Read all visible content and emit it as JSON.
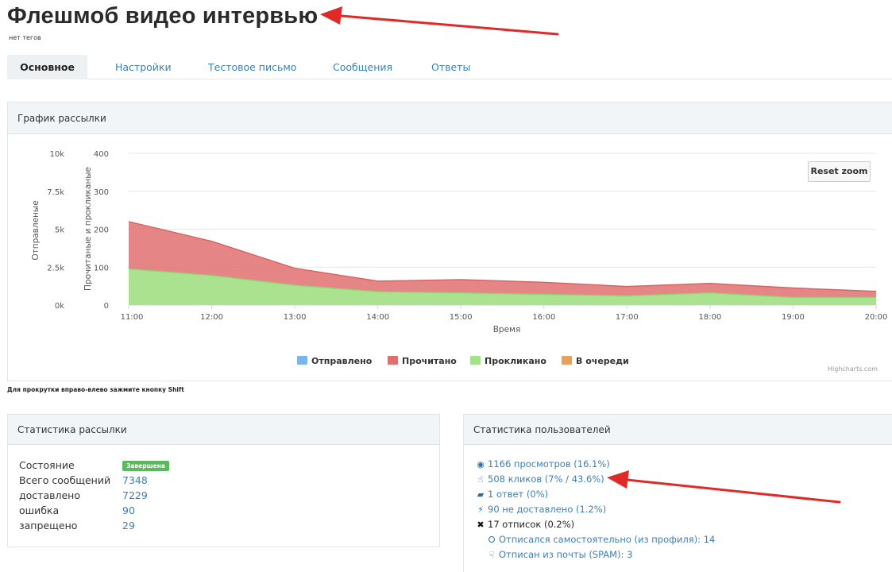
{
  "header": {
    "title": "Флешмоб видео интервью",
    "tags": "нет тегов"
  },
  "tabs": [
    {
      "label": "Основное",
      "active": true
    },
    {
      "label": "Настройки",
      "active": false
    },
    {
      "label": "Тестовое письмо",
      "active": false
    },
    {
      "label": "Сообщения",
      "active": false
    },
    {
      "label": "Ответы",
      "active": false
    }
  ],
  "chart_panel": {
    "title": "График рассылки",
    "reset_zoom": "Reset zoom",
    "credits": "Highcharts.com",
    "scroll_hint": "Для прокрутки вправо-влево зажмите кнопку Shift"
  },
  "chart_data": {
    "type": "area",
    "x": [
      "11:00",
      "12:00",
      "13:00",
      "14:00",
      "15:00",
      "16:00",
      "17:00",
      "18:00",
      "19:00",
      "20:00"
    ],
    "xlabel": "Время",
    "y_left": {
      "label": "Отправленые",
      "ticks": [
        "0k",
        "2.5k",
        "5k",
        "7.5k",
        "10k"
      ],
      "range": [
        0,
        10000
      ]
    },
    "y_right": {
      "label": "Прочитаные и прокликаные",
      "ticks": [
        "0",
        "100",
        "200",
        "300",
        "400"
      ],
      "range": [
        0,
        400
      ]
    },
    "stacked": true,
    "series": [
      {
        "name": "Отправлено",
        "color": "#7cb5ec",
        "values": [
          0,
          0,
          0,
          0,
          0,
          0,
          0,
          0,
          0,
          0
        ]
      },
      {
        "name": "Прочитано",
        "color": "#e07070",
        "values": [
          125,
          90,
          45,
          28,
          35,
          32,
          25,
          25,
          25,
          16
        ]
      },
      {
        "name": "Прокликано",
        "color": "#a5e08a",
        "values": [
          95,
          78,
          52,
          35,
          32,
          28,
          24,
          32,
          20,
          20
        ]
      },
      {
        "name": "В очереди",
        "color": "#e8a05a",
        "values": [
          0,
          0,
          0,
          0,
          0,
          0,
          0,
          0,
          0,
          0
        ]
      }
    ],
    "legend_position": "bottom-center",
    "grid": true
  },
  "mail_stats": {
    "title": "Статистика рассылки",
    "rows": [
      {
        "label": "Состояние",
        "badge": "Завершена"
      },
      {
        "label": "Всего сообщений",
        "value": "7348"
      },
      {
        "label": "доставлено",
        "value": "7229"
      },
      {
        "label": "ошибка",
        "value": "90"
      },
      {
        "label": "запрещено",
        "value": "29"
      }
    ]
  },
  "user_stats": {
    "title": "Статистика пользователей",
    "items": [
      {
        "icon": "eye-icon",
        "glyph": "◉",
        "text": "1166 просмотров (16.1%)"
      },
      {
        "icon": "pointer-hand-icon",
        "glyph": "☝",
        "text": "508 кликов (7% / 43.6%)"
      },
      {
        "icon": "comment-icon",
        "glyph": "▰",
        "text": "1 ответ (0%)"
      },
      {
        "icon": "bolt-icon",
        "glyph": "⚡",
        "text": "90 не доставлено (1.2%)"
      },
      {
        "icon": "close-icon",
        "glyph": "✖",
        "text": "17 отписок (0.2%)"
      },
      {
        "icon": "ban-icon",
        "glyph": "⭘",
        "text": "Отписался самостоятельно (из профиля): 14"
      },
      {
        "icon": "thumbs-down-icon",
        "glyph": "☟",
        "text": "Отписан из почты (SPAM): 3"
      }
    ]
  },
  "colors": {
    "link": "#3d7fb8",
    "arrow": "#e02a2a",
    "badge": "#5cb85c"
  }
}
